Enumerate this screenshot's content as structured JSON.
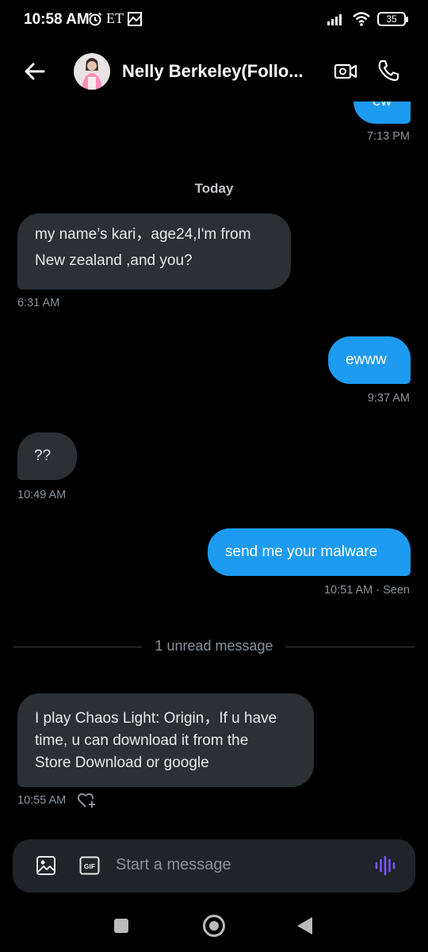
{
  "status_bar": {
    "time": "10:58 AM",
    "et_label": "ET",
    "battery": "35",
    "icons": [
      "alarm-icon",
      "image-notification-icon",
      "signal-icon",
      "wifi-icon",
      "battery-icon"
    ]
  },
  "header": {
    "name": "Nelly Berkeley(Follo...",
    "icons": [
      "back-arrow-icon",
      "video-call-icon",
      "phone-icon"
    ]
  },
  "messages": {
    "m0": {
      "text": "ew",
      "time": "7:13 PM"
    },
    "day_separator": "Today",
    "m1": {
      "line1": "my name’s kari，age24,I'm from",
      "line2": "New zealand ,and you?",
      "time": "6:31 AM"
    },
    "m2": {
      "text": "ewww",
      "time": "9:37 AM"
    },
    "m3": {
      "text": "??",
      "time": "10:49 AM"
    },
    "m4": {
      "text": "send me your malware",
      "time": "10:51 AM · Seen"
    },
    "unread_label": "1 unread message",
    "m5": {
      "line1": "I play Chaos Light: Origin，If u have",
      "line2": "time, u can download it from the",
      "line3": "Store Download or google",
      "time": "10:55 AM"
    }
  },
  "composer": {
    "placeholder": "Start a message",
    "icons": [
      "image-icon",
      "gif-icon",
      "voice-icon"
    ]
  },
  "colors": {
    "outgoing_bubble": "#1d9bf0",
    "incoming_bubble": "#2a3034",
    "voice_accent": "#7856ff",
    "background": "#000000"
  }
}
